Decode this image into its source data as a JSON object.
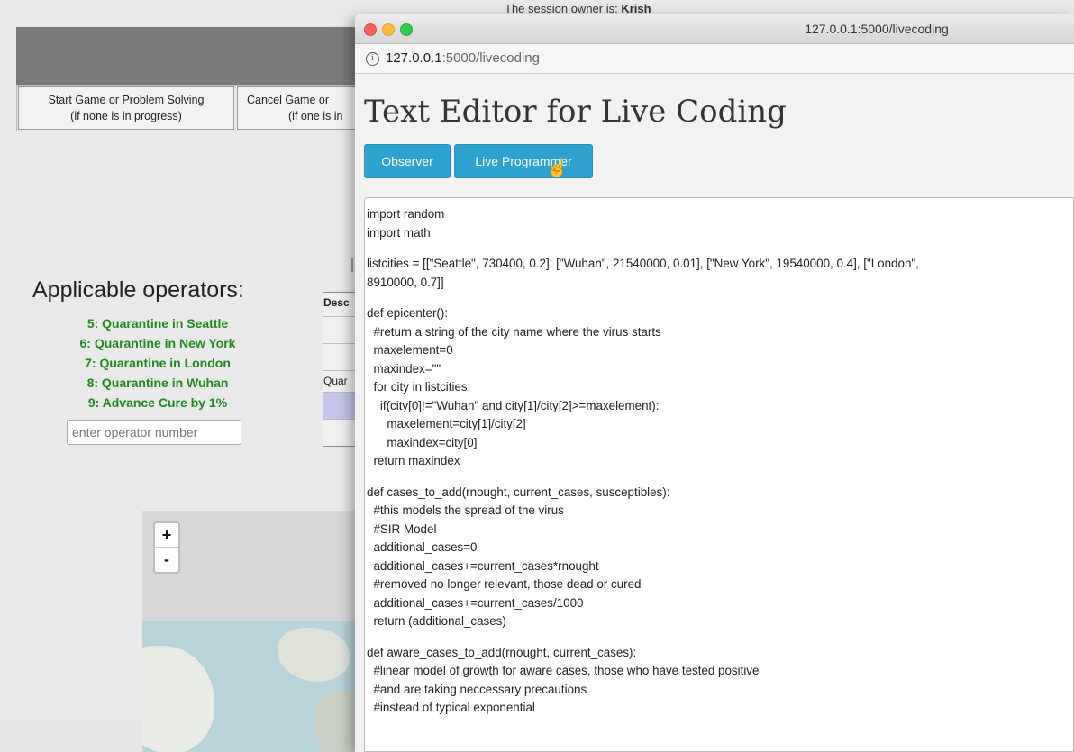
{
  "background": {
    "owner_line_prefix": "The session owner is: ",
    "owner_name": "Krish",
    "buttons": [
      {
        "line1": "Start Game or Problem Solving",
        "line2": "(if none is in progress)"
      },
      {
        "line1": "Cancel Game or",
        "line2": "(if one is in"
      }
    ],
    "operators_title": "Applicable operators:",
    "operators": [
      "5: Quarantine in Seattle",
      "6: Quarantine in New York",
      "7: Quarantine in London",
      "8: Quarantine in Wuhan",
      "9: Advance Cure by 1%"
    ],
    "operator_input_placeholder": "enter operator number",
    "table": {
      "header": "Desc",
      "row": "Quar"
    },
    "map": {
      "zoom_in": "+",
      "zoom_out": "-"
    }
  },
  "popup": {
    "window_title": "127.0.0.1:5000/livecoding",
    "url_host": "127.0.0.1",
    "url_path": ":5000/livecoding",
    "page_title": "Text Editor for Live Coding",
    "observer_button": "Observer",
    "programmer_button": "Live Programmer",
    "code_lines": [
      "import random",
      "import math",
      "",
      "listcities = [[\"Seattle\", 730400, 0.2], [\"Wuhan\", 21540000, 0.01], [\"New York\", 19540000, 0.4], [\"London\",",
      "8910000, 0.7]]",
      "",
      "def epicenter():",
      "  #return a string of the city name where the virus starts",
      "  maxelement=0",
      "  maxindex=\"\"",
      "  for city in listcities:",
      "    if(city[0]!=\"Wuhan\" and city[1]/city[2]>=maxelement):",
      "      maxelement=city[1]/city[2]",
      "      maxindex=city[0]",
      "  return maxindex",
      "",
      "def cases_to_add(rnought, current_cases, susceptibles):",
      "  #this models the spread of the virus",
      "  #SIR Model",
      "  additional_cases=0",
      "  additional_cases+=current_cases*rnought",
      "  #removed no longer relevant, those dead or cured",
      "  additional_cases+=current_cases/1000",
      "  return (additional_cases)",
      "",
      "def aware_cases_to_add(rnought, current_cases):",
      "  #linear model of growth for aware cases, those who have tested positive",
      "  #and are taking neccessary precautions",
      "  #instead of typical exponential"
    ]
  }
}
